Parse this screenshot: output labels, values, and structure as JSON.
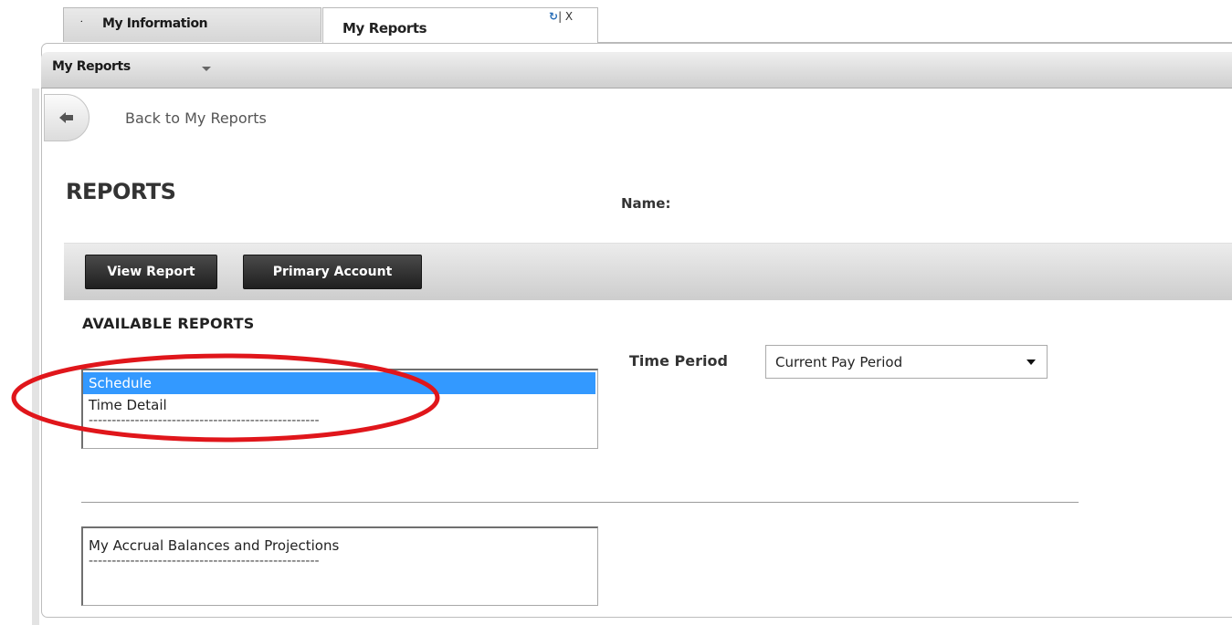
{
  "tabs": {
    "my_information": "My Information",
    "my_reports": "My Reports",
    "controls": "| X"
  },
  "subnav": {
    "label": "My Reports"
  },
  "back": {
    "label": "Back to My Reports"
  },
  "page": {
    "title": "REPORTS",
    "name_label": "Name:"
  },
  "toolbar": {
    "view_report": "View Report",
    "primary_account": "Primary Account"
  },
  "available_reports": {
    "heading": "AVAILABLE REPORTS",
    "group1": [
      "Schedule",
      "Time Detail"
    ],
    "selected": "Schedule",
    "group2": [
      "My Accrual Balances and Projections"
    ],
    "separator": "--------------------------------------------------"
  },
  "time_period": {
    "label": "Time Period",
    "value": "Current Pay Period"
  },
  "colors": {
    "selection": "#3399ff",
    "annotation": "#e0161b",
    "button": "#2b2b2b"
  },
  "icons": [
    "home-icon",
    "refresh-icon",
    "chevron-down-icon",
    "back-arrow-icon"
  ]
}
